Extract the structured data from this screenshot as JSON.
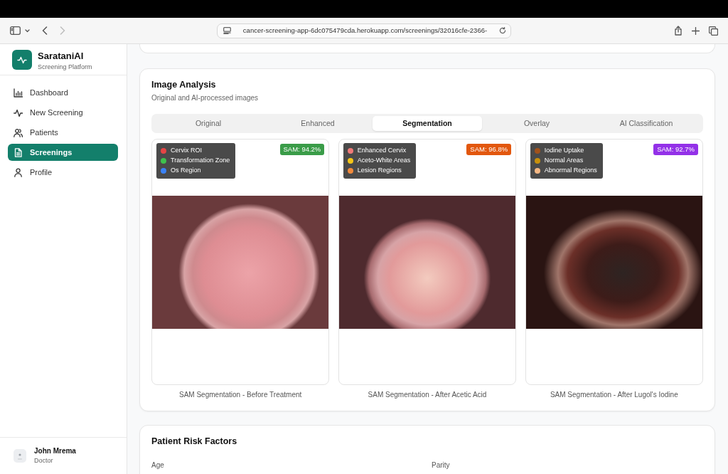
{
  "browser": {
    "back": {
      "disabled": false
    },
    "forward": {
      "disabled": true
    },
    "url": "cancer-screening-app-6dc075479cda.herokuapp.com/screenings/32016cfe-2366-"
  },
  "sidebar": {
    "brand": {
      "title": "SarataniAI",
      "subtitle": "Screening Platform"
    },
    "items": [
      {
        "kind": "dashboard",
        "label": "Dashboard",
        "selected": false
      },
      {
        "kind": "new",
        "label": "New Screening",
        "selected": false
      },
      {
        "kind": "patients",
        "label": "Patients",
        "selected": false
      },
      {
        "kind": "screenings",
        "label": "Screenings",
        "selected": true
      },
      {
        "kind": "profile",
        "label": "Profile",
        "selected": false
      }
    ],
    "user": {
      "name": "John Mrema",
      "role": "Doctor"
    }
  },
  "image_analysis": {
    "title": "Image Analysis",
    "subtitle": "Original and AI-processed images",
    "tabs": [
      {
        "label": "Original",
        "selected": false
      },
      {
        "label": "Enhanced",
        "selected": false
      },
      {
        "label": "Segmentation",
        "selected": true
      },
      {
        "label": "Overlay",
        "selected": false
      },
      {
        "label": "AI Classification",
        "selected": false
      }
    ],
    "panels": [
      {
        "badge": "SAM: 94.2%",
        "color": "#3a9c48",
        "legend": [
          {
            "label": "Cervix ROI",
            "color": "#e64545"
          },
          {
            "label": "Transformation Zone",
            "color": "#3fc24d"
          },
          {
            "label": "Os Region",
            "color": "#3b82f6"
          }
        ],
        "caption": "SAM Segmentation - Before Treatment"
      },
      {
        "badge": "SAM: 96.8%",
        "color": "#e2570e",
        "legend": [
          {
            "label": "Enhanced Cervix",
            "color": "#f07a78"
          },
          {
            "label": "Aceto-White Areas",
            "color": "#f5c518"
          },
          {
            "label": "Lesion Regions",
            "color": "#f08a3c"
          }
        ],
        "caption": "SAM Segmentation - After Acetic Acid"
      },
      {
        "badge": "SAM: 92.7%",
        "color": "#9331e8",
        "legend": [
          {
            "label": "Iodine Uptake",
            "color": "#a0521c"
          },
          {
            "label": "Normal Areas",
            "color": "#c8900c"
          },
          {
            "label": "Abnormal Regions",
            "color": "#f5b884"
          }
        ],
        "caption": "SAM Segmentation - After Lugol's Iodine"
      }
    ]
  },
  "risk_factors": {
    "title": "Patient Risk Factors",
    "fields": [
      {
        "label": "Age"
      },
      {
        "label": "Parity"
      }
    ]
  }
}
